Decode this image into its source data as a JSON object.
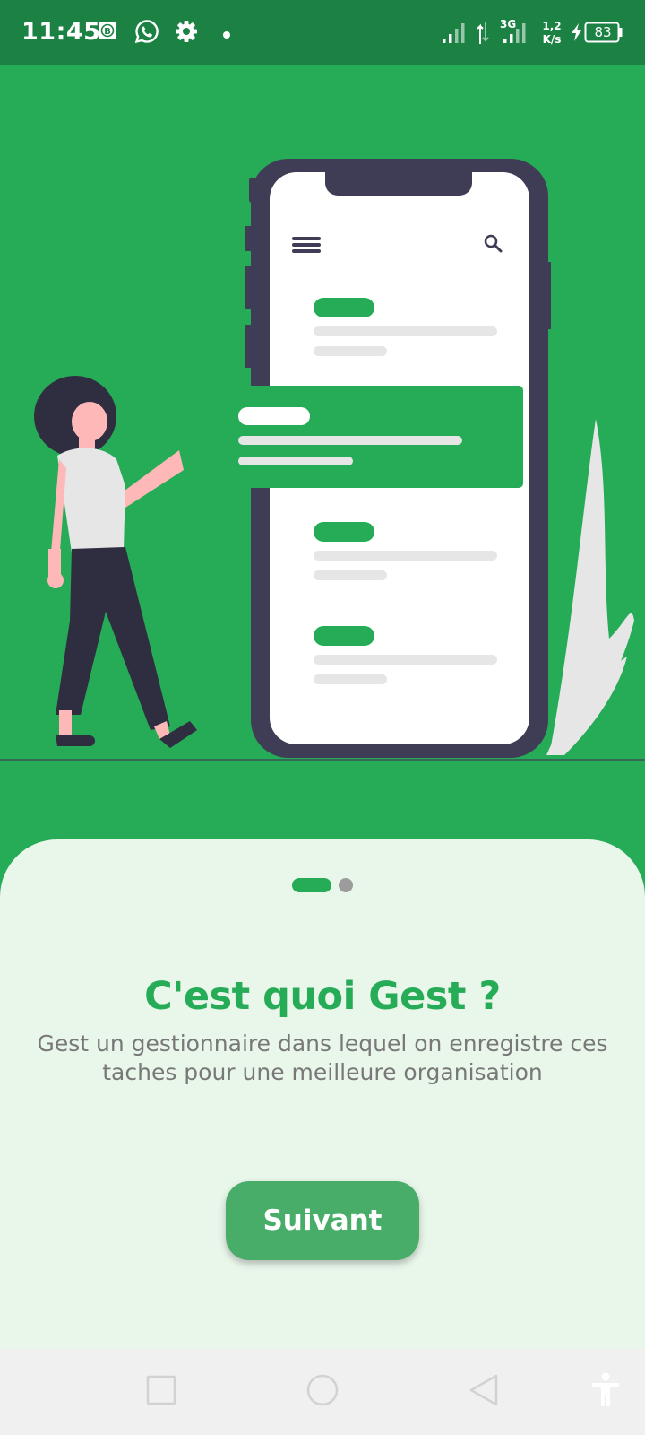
{
  "status_bar": {
    "time": "11:45",
    "network_type": "3G",
    "speed_value": "1,2",
    "speed_unit": "K/s",
    "battery_level": "83",
    "icons": [
      "app-notification-icon",
      "whatsapp-icon",
      "settings-icon",
      "notification-dot-icon",
      "signal-icon",
      "data-transfer-icon",
      "signal-3g-icon",
      "charging-icon",
      "battery-icon"
    ]
  },
  "onboarding": {
    "pager": {
      "total_pages": 2,
      "current_page": 1
    },
    "title": "C'est quoi Gest ?",
    "description": "Gest un gestionnaire dans lequel on enregistre ces taches pour une meilleure organisation",
    "next_label": "Suivant"
  },
  "colors": {
    "primary_green": "#26ab57",
    "status_bar_green": "#1b8244",
    "sheet_background": "#e9f6ea",
    "button_green": "#47ad68",
    "phone_frame": "#3f3d56"
  },
  "nav_bar": {
    "buttons": [
      "recent-apps-icon",
      "home-icon",
      "back-icon",
      "accessibility-icon"
    ]
  }
}
